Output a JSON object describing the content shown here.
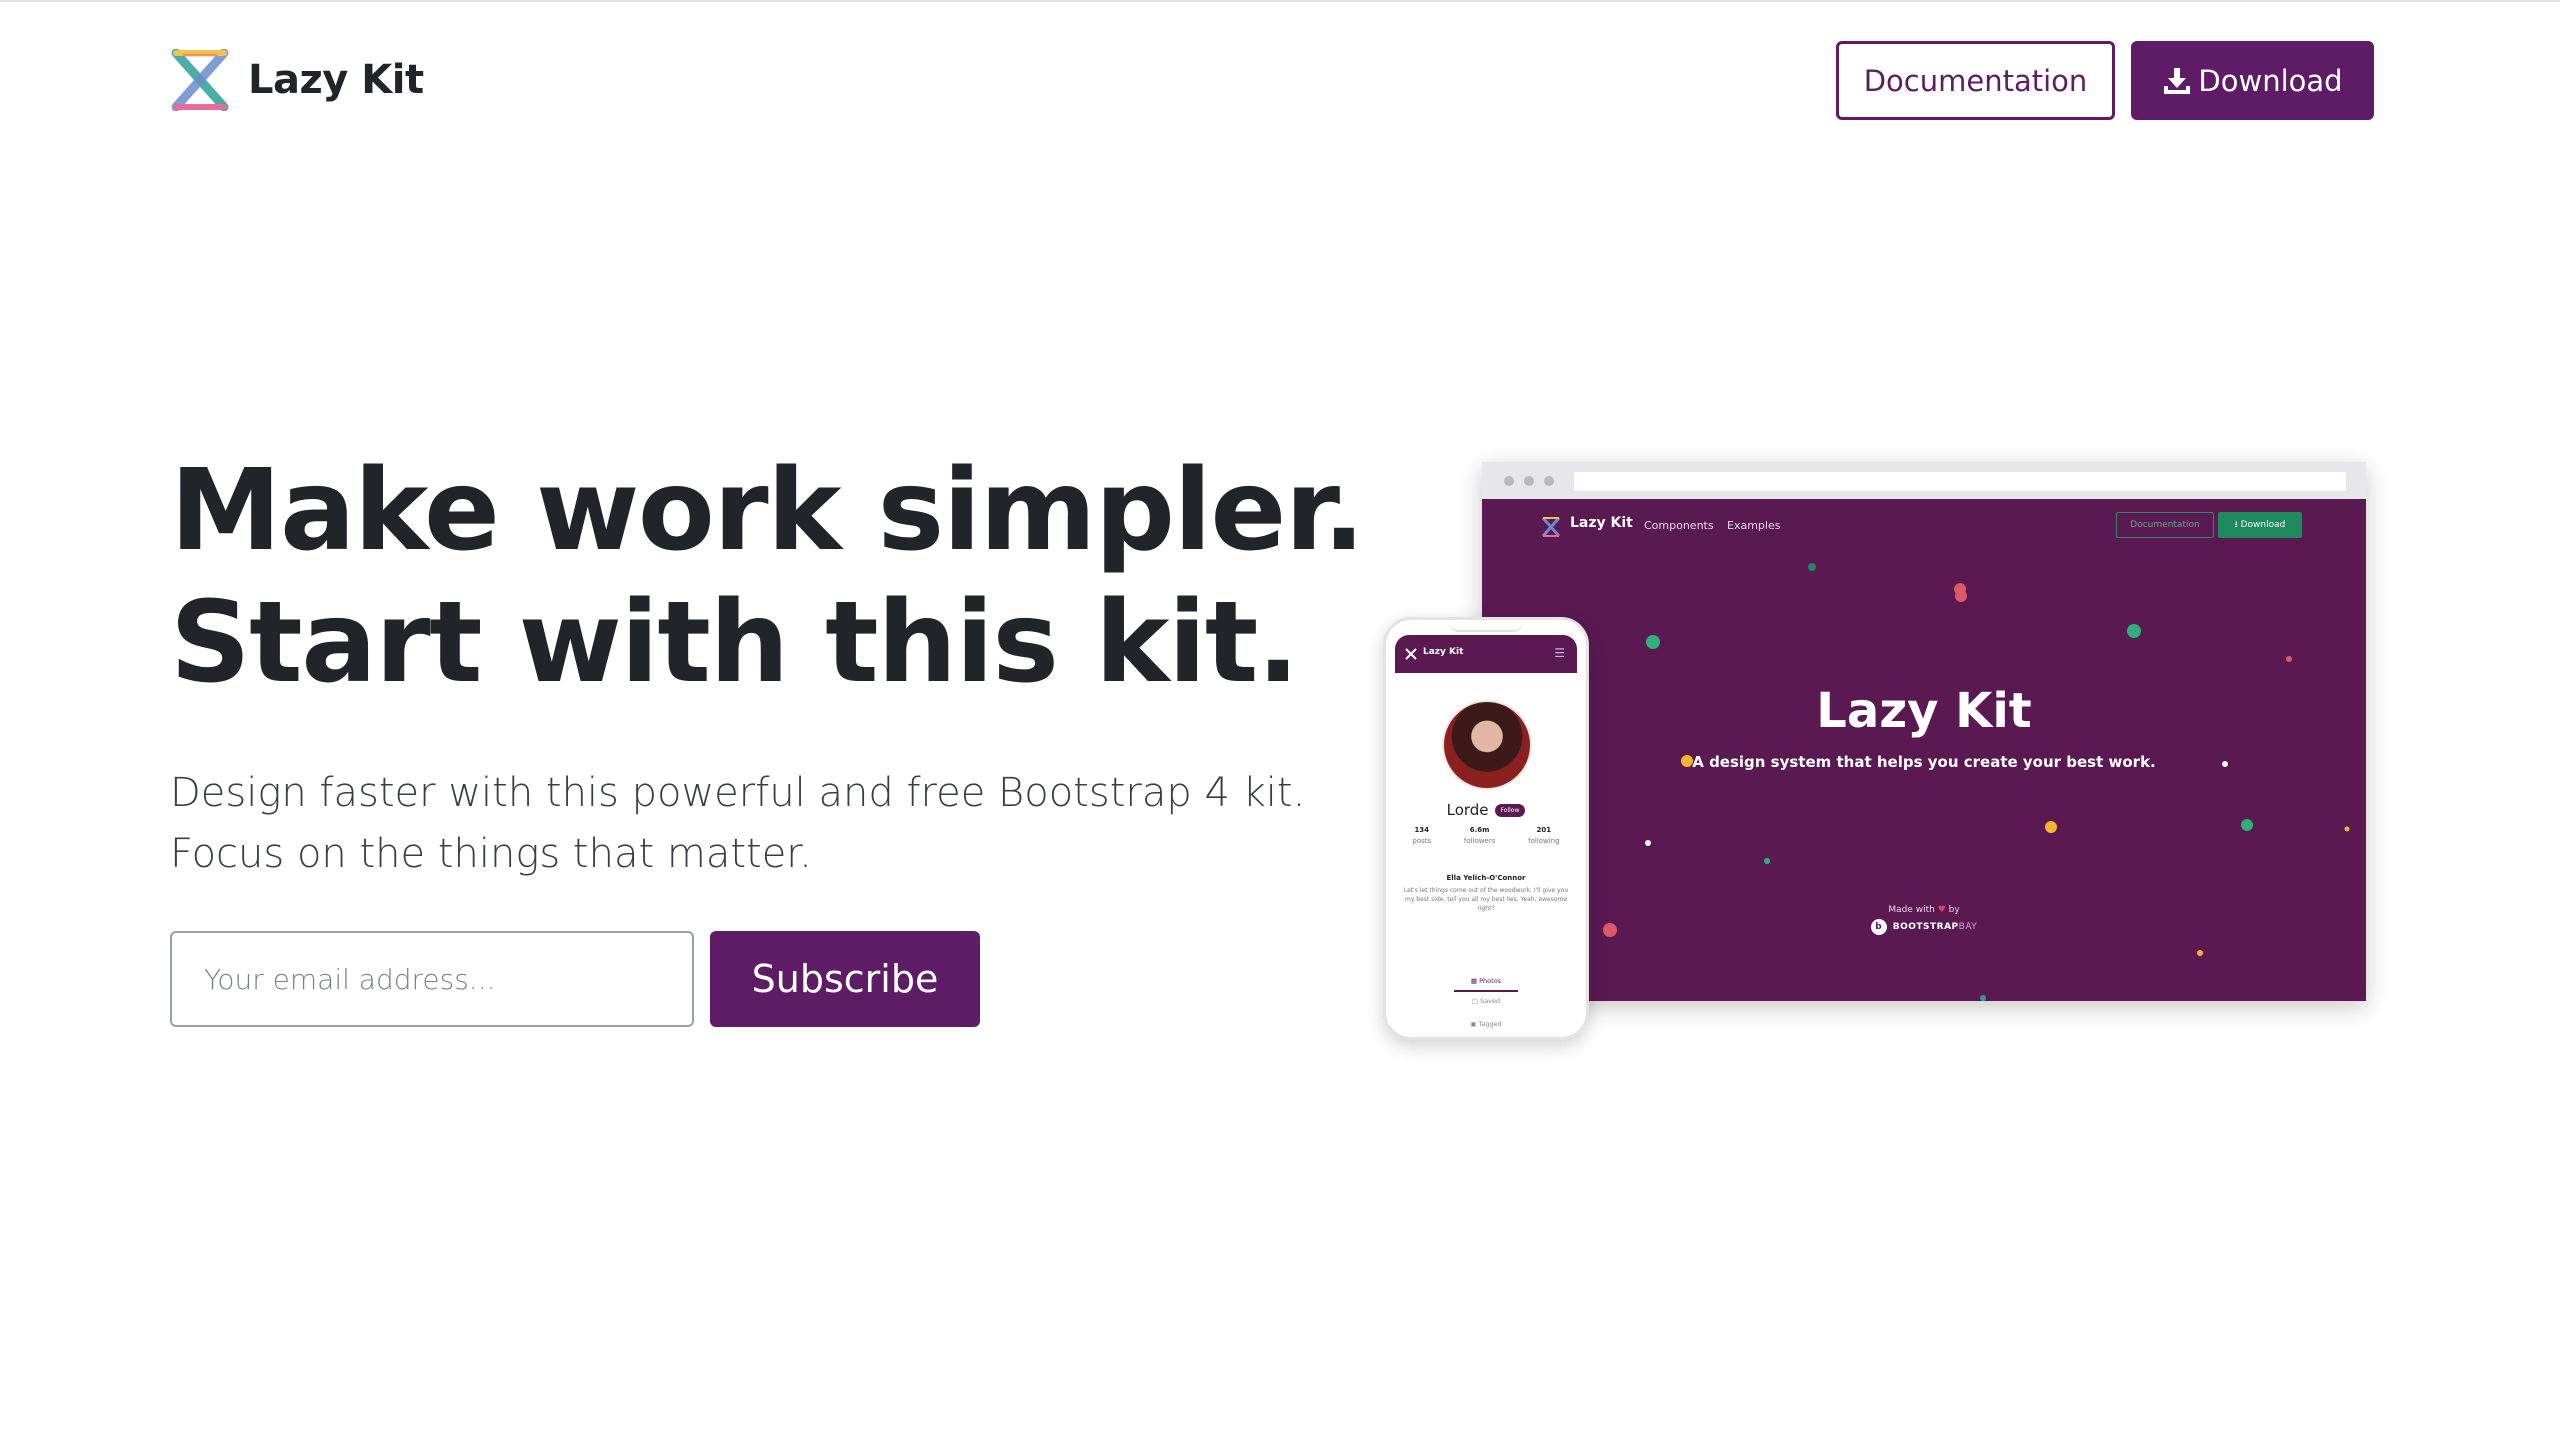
{
  "header": {
    "brand": "Lazy Kit",
    "documentation_label": "Documentation",
    "download_label": "Download"
  },
  "hero": {
    "title_line1": "Make work simpler.",
    "title_line2": "Start with this kit.",
    "subtitle_line1": "Design faster with this powerful and free Bootstrap 4 kit.",
    "subtitle_line2": "Focus on the things that matter.",
    "email_placeholder": "Your email address...",
    "subscribe_label": "Subscribe"
  },
  "browser_preview": {
    "brand": "Lazy Kit",
    "nav": [
      "Components",
      "Examples"
    ],
    "documentation_label": "Documentation",
    "download_label": "Download",
    "title": "Lazy Kit",
    "subtitle": "A design system that helps you create your best work.",
    "made_with": "Made with",
    "by": "by",
    "bootstrap": "BOOTSTRAP",
    "bay": "BAY",
    "background_color": "#5b1952"
  },
  "phone_preview": {
    "brand": "Lazy Kit",
    "name": "Lorde",
    "follow_label": "Follow",
    "stats": [
      {
        "value": "134",
        "label": "posts"
      },
      {
        "value": "6.6m",
        "label": "followers"
      },
      {
        "value": "201",
        "label": "following"
      }
    ],
    "full_name": "Ella Yelich-O'Connor",
    "bio": "Let's let things come out of the woodwork. I'll give you my best side, tell you all my best lies. Yeah, awesome right?",
    "tabs": [
      "Photos",
      "Saved",
      "Tagged"
    ]
  },
  "colors": {
    "brand_purple": "#5e1c66",
    "text_dark": "#212529",
    "preview_green": "#1f8a5e"
  },
  "icons": {
    "logo": "lazy-kit-x-logo",
    "download": "download-icon"
  }
}
